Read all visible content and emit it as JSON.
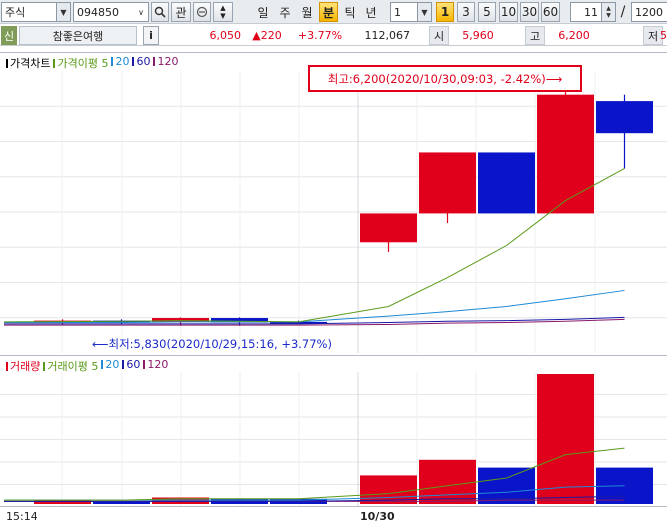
{
  "toolbar": {
    "market": "주식",
    "code": "094850",
    "gwan": "관",
    "periods": [
      "일",
      "주",
      "월",
      "분",
      "틱",
      "년"
    ],
    "active_period": "분",
    "count_select": "1",
    "intervals": [
      "1",
      "3",
      "5",
      "10",
      "30",
      "60"
    ],
    "active_interval": "1",
    "spin_value": "11",
    "slash": "/",
    "total_value": "1200"
  },
  "quote": {
    "badge": "신",
    "name": "참좋은여행",
    "info_button": "i",
    "price": "6,050",
    "change": "▲220",
    "change_pct": "+3.77%",
    "volume": "112,067",
    "open_label": "시",
    "open": "5,960",
    "high_label": "고",
    "high": "6,200",
    "low_label": "저",
    "low_partial": "5"
  },
  "price_panel": {
    "legend": [
      {
        "text": "가격차트",
        "color": "#000000"
      },
      {
        "text": "가격이평 5",
        "color": "#5a9a1a"
      },
      {
        "text": "20",
        "color": "#1e8ad6"
      },
      {
        "text": "60",
        "color": "#1a1aa6"
      },
      {
        "text": "120",
        "color": "#8a1a6a"
      }
    ],
    "high_callout": "최고:6,200(2020/10/30,09:03, -2.42%)⟶",
    "low_callout": "⟵최저:5,830(2020/10/29,15:16, +3.77%)"
  },
  "volume_panel": {
    "legend": [
      {
        "text": "거래량",
        "color": "#e0001b"
      },
      {
        "text": "거래이평 5",
        "color": "#5a9a1a"
      },
      {
        "text": "20",
        "color": "#1e8ad6"
      },
      {
        "text": "60",
        "color": "#1a1aa6"
      },
      {
        "text": "120",
        "color": "#8a1a6a"
      }
    ]
  },
  "time_axis": {
    "labels": [
      "15:14",
      "10/30"
    ]
  },
  "colors": {
    "up": "#e0001b",
    "down": "#0a14c8",
    "ma5": "#5a9a1a",
    "ma20": "#1e8ad6",
    "ma60": "#1a1aa6",
    "ma120": "#8a1a6a"
  },
  "chart_data": {
    "type": "candlestick",
    "note_ranges": "price approx 5,830 – 6,200",
    "candles": [
      {
        "open": 5835,
        "close": 5838,
        "high": 5840,
        "low": 5832,
        "dir": "up"
      },
      {
        "open": 5838,
        "close": 5836,
        "high": 5840,
        "low": 5833,
        "dir": "down"
      },
      {
        "open": 5836,
        "close": 5842,
        "high": 5843,
        "low": 5830,
        "dir": "up"
      },
      {
        "open": 5842,
        "close": 5835,
        "high": 5843,
        "low": 5830,
        "dir": "down"
      },
      {
        "open": 5835,
        "close": 5836,
        "high": 5838,
        "low": 5833,
        "dir": "down"
      },
      {
        "open": 5960,
        "close": 6005,
        "high": 6005,
        "low": 5945,
        "dir": "up"
      },
      {
        "open": 6005,
        "close": 6100,
        "high": 6100,
        "low": 5990,
        "dir": "up"
      },
      {
        "open": 6100,
        "close": 6005,
        "high": 6100,
        "low": 6005,
        "dir": "down"
      },
      {
        "open": 6005,
        "close": 6190,
        "high": 6200,
        "low": 6005,
        "dir": "up"
      },
      {
        "open": 6180,
        "close": 6130,
        "high": 6190,
        "low": 6075,
        "dir": "down"
      }
    ],
    "volume": [
      {
        "v": 3,
        "dir": "up"
      },
      {
        "v": 2,
        "dir": "down"
      },
      {
        "v": 5,
        "dir": "up"
      },
      {
        "v": 4,
        "dir": "down"
      },
      {
        "v": 4,
        "dir": "down"
      },
      {
        "v": 22,
        "dir": "up"
      },
      {
        "v": 34,
        "dir": "up"
      },
      {
        "v": 28,
        "dir": "down"
      },
      {
        "v": 100,
        "dir": "up"
      },
      {
        "v": 28,
        "dir": "down"
      }
    ]
  }
}
